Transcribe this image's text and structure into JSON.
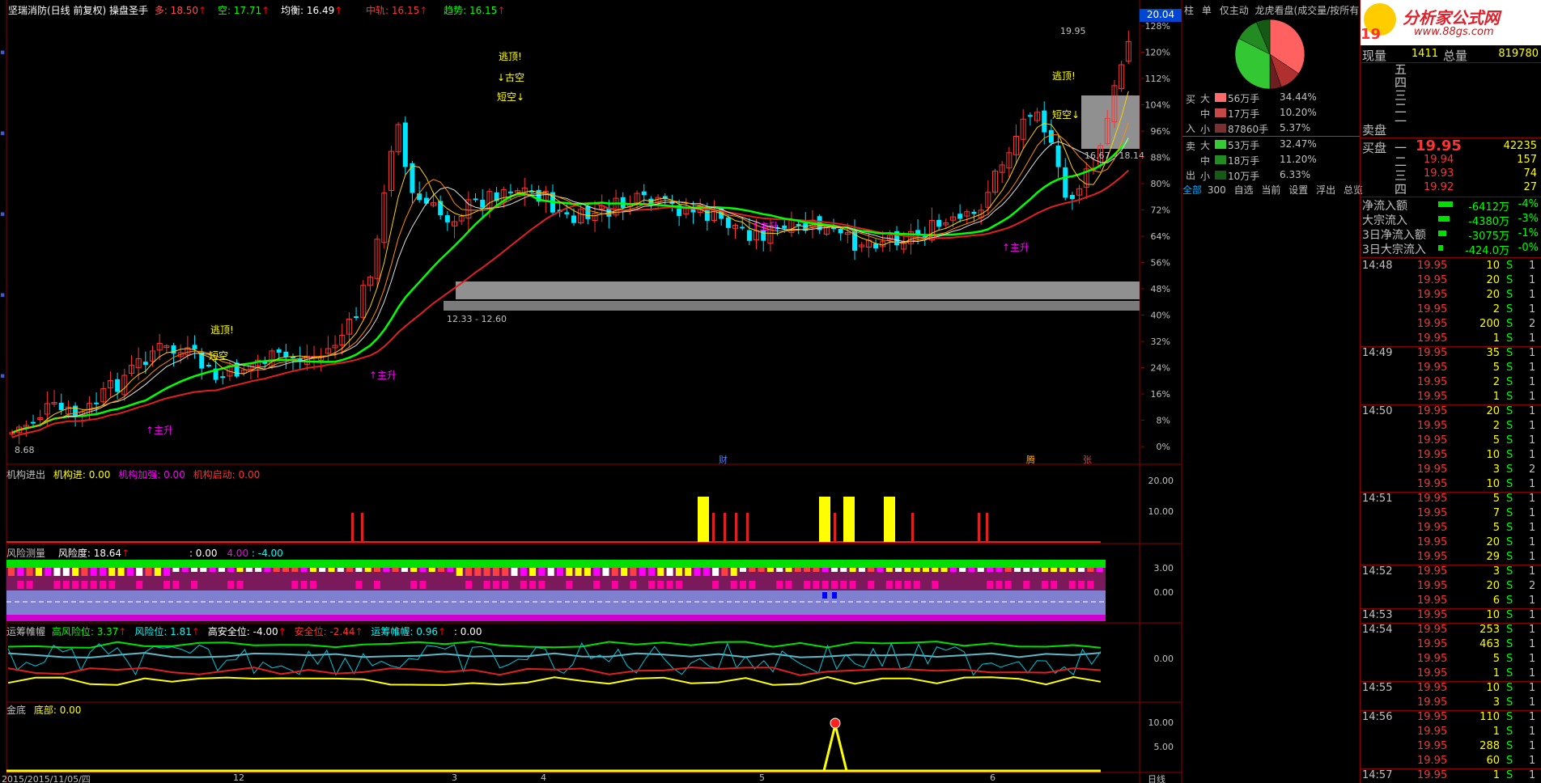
{
  "header": {
    "title": "坚瑞消防(日线 前复权) 操盘圣手",
    "duo_label": "多: 18.50",
    "kong_label": "空: 17.71",
    "junheng_label": "均衡: 16.49",
    "zhonggui_label": "中轨: 16.15",
    "qushi_label": "趋势: 16.15",
    "price_box": "20.04"
  },
  "colors": {
    "up": "#ff3232",
    "down": "#00e5ff",
    "green": "#00ff00",
    "yellow": "#ffff00",
    "magenta": "#ff00ff",
    "white": "#ffffff",
    "grid": "#8b0000"
  },
  "main_chart": {
    "annotations": [
      {
        "text": "逃顶!",
        "color": "#ffff00"
      },
      {
        "text": "↓古空",
        "color": "#ffff00"
      },
      {
        "text": "短空↓",
        "color": "#ffff00"
      },
      {
        "text": "逃顶!",
        "color": "#ffff00"
      },
      {
        "text": "短空",
        "color": "#ffff00"
      },
      {
        "text": "逃顶!",
        "color": "#ffff00"
      },
      {
        "text": "短空↓",
        "color": "#ffff00"
      },
      {
        "text": "↑主升",
        "color": "#ff00ff"
      },
      {
        "text": "↑主升",
        "color": "#ff00ff"
      },
      {
        "text": "↑主升",
        "color": "#ff00ff"
      },
      {
        "text": "↑主升",
        "color": "#ff00ff"
      }
    ],
    "price_labels": [
      "19.95",
      "8.68",
      "12.33 - 12.60",
      "16.67 - 18.14"
    ],
    "markers": [
      "财",
      "腾",
      "张"
    ],
    "y_ticks": [
      "128%",
      "120%",
      "112%",
      "104%",
      "96%",
      "88%",
      "80%",
      "72%",
      "64%",
      "56%",
      "48%",
      "40%",
      "32%",
      "24%",
      "16%",
      "8%",
      "0%"
    ]
  },
  "panel_jigou": {
    "title": "机构进出",
    "jigoujin": "机构进: 0.00",
    "jiaqiang": "机构加强: 0.00",
    "qidong": "机构启动: 0.00",
    "y_ticks": [
      "20.00",
      "10.00"
    ]
  },
  "panel_risk": {
    "title": "风险测量",
    "risk": "风险度: 18.64",
    "v1": ": 0.00",
    "v2": "4.00",
    "v3": ": -4.00",
    "y_ticks": [
      "3.00",
      "0.00"
    ]
  },
  "panel_yunchou": {
    "title": "运筹帷幄",
    "gaofengxian": "高风险位: 3.37",
    "fengxian": "风险位: 1.81",
    "gaoanquan": "高安全位: -4.00",
    "anquan": "安全位: -2.44",
    "yunchou": "运筹帷幄: 0.96",
    "last": ": 0.00",
    "y_ticks": [
      "0.00"
    ]
  },
  "panel_jindi": {
    "title": "金底",
    "didi": "底部: 0.00",
    "y_ticks": [
      "10.00",
      "5.00"
    ]
  },
  "bottom_axis": {
    "date_label": "2015/2015/11/05/四",
    "months": [
      "12",
      "3",
      "4",
      "5",
      "6"
    ],
    "period": "日线"
  },
  "mid_panel": {
    "tabs": [
      "柱",
      "单",
      "仅主动",
      "龙虎看盘(成交量/按所有)"
    ],
    "pie_percent": [
      34.44,
      10.2,
      5.37,
      32.47,
      11.2,
      6.33
    ],
    "buy_label": [
      "买",
      "入"
    ],
    "sell_label": [
      "卖",
      "出"
    ],
    "rows": [
      {
        "side": "大",
        "amount": "56万手",
        "pct": "34.44%",
        "color": "#ff6a6a"
      },
      {
        "side": "中",
        "amount": "17万手",
        "pct": "10.20%",
        "color": "#c84848"
      },
      {
        "side": "小",
        "amount": "87860手",
        "pct": "5.37%",
        "color": "#7a3030"
      },
      {
        "side": "大",
        "amount": "53万手",
        "pct": "32.47%",
        "color": "#33cc33"
      },
      {
        "side": "中",
        "amount": "18万手",
        "pct": "11.20%",
        "color": "#228b22"
      },
      {
        "side": "小",
        "amount": "10万手",
        "pct": "6.33%",
        "color": "#145a14"
      }
    ],
    "footer": [
      "全部",
      "300",
      "自选",
      "当前",
      "设置",
      "浮出",
      "总览"
    ]
  },
  "right_panel": {
    "logo_text": "分析家公式网",
    "logo_url": "www.88gs.com",
    "price_big": "19",
    "xianliang_label": "现量",
    "xianliang": "1411",
    "zongliang_label": "总量",
    "zongliang": "819780",
    "sell_levels": [
      "五",
      "四",
      "三",
      "二",
      "一"
    ],
    "maipan_label": "卖盘",
    "buy_label": "买盘",
    "buy_levels": [
      {
        "level": "一",
        "price": "19.95",
        "vol": "42235"
      },
      {
        "level": "二",
        "price": "19.94",
        "vol": "157"
      },
      {
        "level": "三",
        "price": "19.93",
        "vol": "74"
      },
      {
        "level": "四",
        "price": "19.92",
        "vol": "27"
      }
    ],
    "flows": [
      {
        "label": "净流入额",
        "value": "-6412万",
        "pct": "-4%"
      },
      {
        "label": "大宗流入",
        "value": "-4380万",
        "pct": "-3%"
      },
      {
        "label": "3日净流入额",
        "value": "-3075万",
        "pct": "-1%"
      },
      {
        "label": "3日大宗流入",
        "value": "-424.0万",
        "pct": "-0%"
      }
    ],
    "trades": [
      {
        "time": "14:48",
        "price": "19.95",
        "vol": "10",
        "bs": "S",
        "n": "1"
      },
      {
        "time": "",
        "price": "19.95",
        "vol": "20",
        "bs": "S",
        "n": "1"
      },
      {
        "time": "",
        "price": "19.95",
        "vol": "20",
        "bs": "S",
        "n": "1"
      },
      {
        "time": "",
        "price": "19.95",
        "vol": "2",
        "bs": "S",
        "n": "1"
      },
      {
        "time": "",
        "price": "19.95",
        "vol": "200",
        "bs": "S",
        "n": "2"
      },
      {
        "time": "",
        "price": "19.95",
        "vol": "1",
        "bs": "S",
        "n": "1"
      },
      {
        "time": "14:49",
        "price": "19.95",
        "vol": "35",
        "bs": "S",
        "n": "1"
      },
      {
        "time": "",
        "price": "19.95",
        "vol": "5",
        "bs": "S",
        "n": "1"
      },
      {
        "time": "",
        "price": "19.95",
        "vol": "2",
        "bs": "S",
        "n": "1"
      },
      {
        "time": "",
        "price": "19.95",
        "vol": "1",
        "bs": "S",
        "n": "1"
      },
      {
        "time": "14:50",
        "price": "19.95",
        "vol": "20",
        "bs": "S",
        "n": "1"
      },
      {
        "time": "",
        "price": "19.95",
        "vol": "2",
        "bs": "S",
        "n": "1"
      },
      {
        "time": "",
        "price": "19.95",
        "vol": "5",
        "bs": "S",
        "n": "1"
      },
      {
        "time": "",
        "price": "19.95",
        "vol": "10",
        "bs": "S",
        "n": "1"
      },
      {
        "time": "",
        "price": "19.95",
        "vol": "3",
        "bs": "S",
        "n": "2"
      },
      {
        "time": "",
        "price": "19.95",
        "vol": "10",
        "bs": "S",
        "n": "1"
      },
      {
        "time": "14:51",
        "price": "19.95",
        "vol": "5",
        "bs": "S",
        "n": "1"
      },
      {
        "time": "",
        "price": "19.95",
        "vol": "7",
        "bs": "S",
        "n": "1"
      },
      {
        "time": "",
        "price": "19.95",
        "vol": "5",
        "bs": "S",
        "n": "1"
      },
      {
        "time": "",
        "price": "19.95",
        "vol": "20",
        "bs": "S",
        "n": "1"
      },
      {
        "time": "",
        "price": "19.95",
        "vol": "29",
        "bs": "S",
        "n": "1"
      },
      {
        "time": "14:52",
        "price": "19.95",
        "vol": "3",
        "bs": "S",
        "n": "1"
      },
      {
        "time": "",
        "price": "19.95",
        "vol": "20",
        "bs": "S",
        "n": "2"
      },
      {
        "time": "",
        "price": "19.95",
        "vol": "6",
        "bs": "S",
        "n": "1"
      },
      {
        "time": "14:53",
        "price": "19.95",
        "vol": "10",
        "bs": "S",
        "n": "1"
      },
      {
        "time": "14:54",
        "price": "19.95",
        "vol": "253",
        "bs": "S",
        "n": "1"
      },
      {
        "time": "",
        "price": "19.95",
        "vol": "463",
        "bs": "S",
        "n": "1"
      },
      {
        "time": "",
        "price": "19.95",
        "vol": "5",
        "bs": "S",
        "n": "1"
      },
      {
        "time": "",
        "price": "19.95",
        "vol": "1",
        "bs": "S",
        "n": "1"
      },
      {
        "time": "14:55",
        "price": "19.95",
        "vol": "10",
        "bs": "S",
        "n": "1"
      },
      {
        "time": "",
        "price": "19.95",
        "vol": "3",
        "bs": "S",
        "n": "1"
      },
      {
        "time": "14:56",
        "price": "19.95",
        "vol": "110",
        "bs": "S",
        "n": "1"
      },
      {
        "time": "",
        "price": "19.95",
        "vol": "1",
        "bs": "S",
        "n": "1"
      },
      {
        "time": "",
        "price": "19.95",
        "vol": "288",
        "bs": "S",
        "n": "1"
      },
      {
        "time": "",
        "price": "19.95",
        "vol": "60",
        "bs": "S",
        "n": "1"
      },
      {
        "time": "14:57",
        "price": "19.95",
        "vol": "1",
        "bs": "S",
        "n": "1"
      }
    ]
  }
}
